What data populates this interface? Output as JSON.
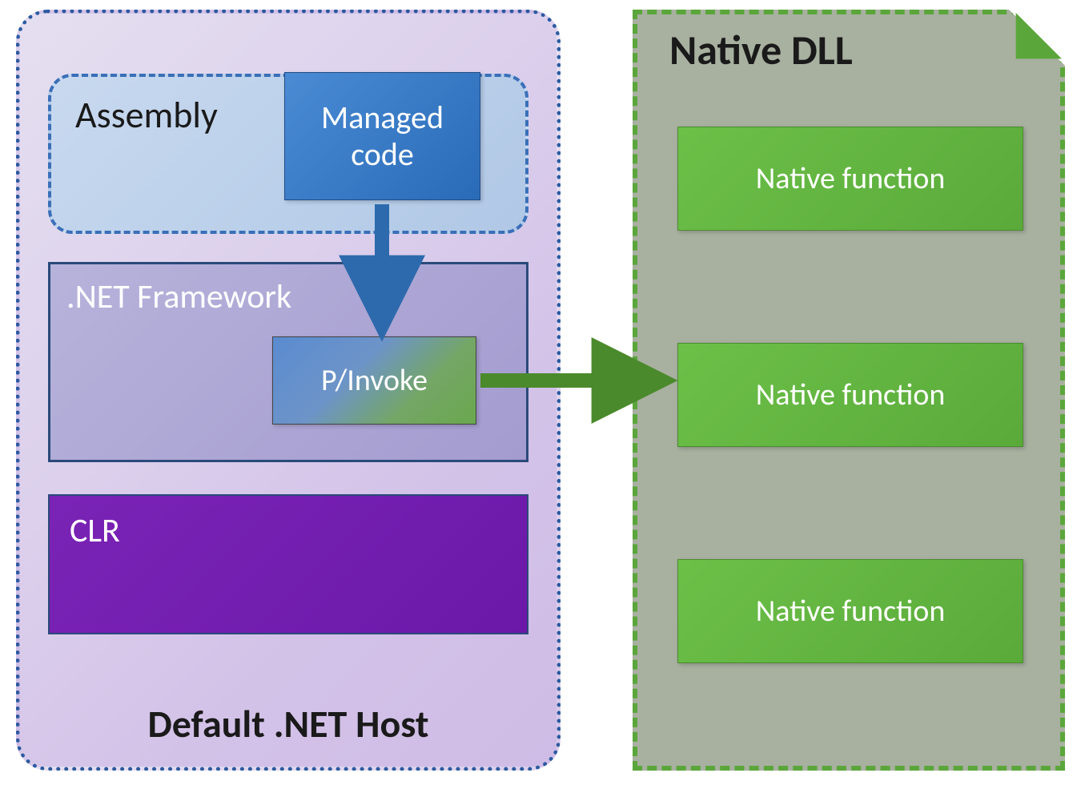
{
  "host": {
    "title": "Default .NET Host",
    "assembly": {
      "label": "Assembly",
      "managed_code": "Managed\ncode"
    },
    "framework": {
      "label": ".NET Framework",
      "pinvoke": "P/Invoke"
    },
    "clr": "CLR"
  },
  "native_dll": {
    "title": "Native DLL",
    "functions": [
      "Native function",
      "Native function",
      "Native function"
    ]
  },
  "colors": {
    "host_border": "#2b5aa0",
    "native_border": "#5aa63a",
    "blue_arrow": "#2d6aad",
    "green_arrow": "#4b8a2c"
  }
}
